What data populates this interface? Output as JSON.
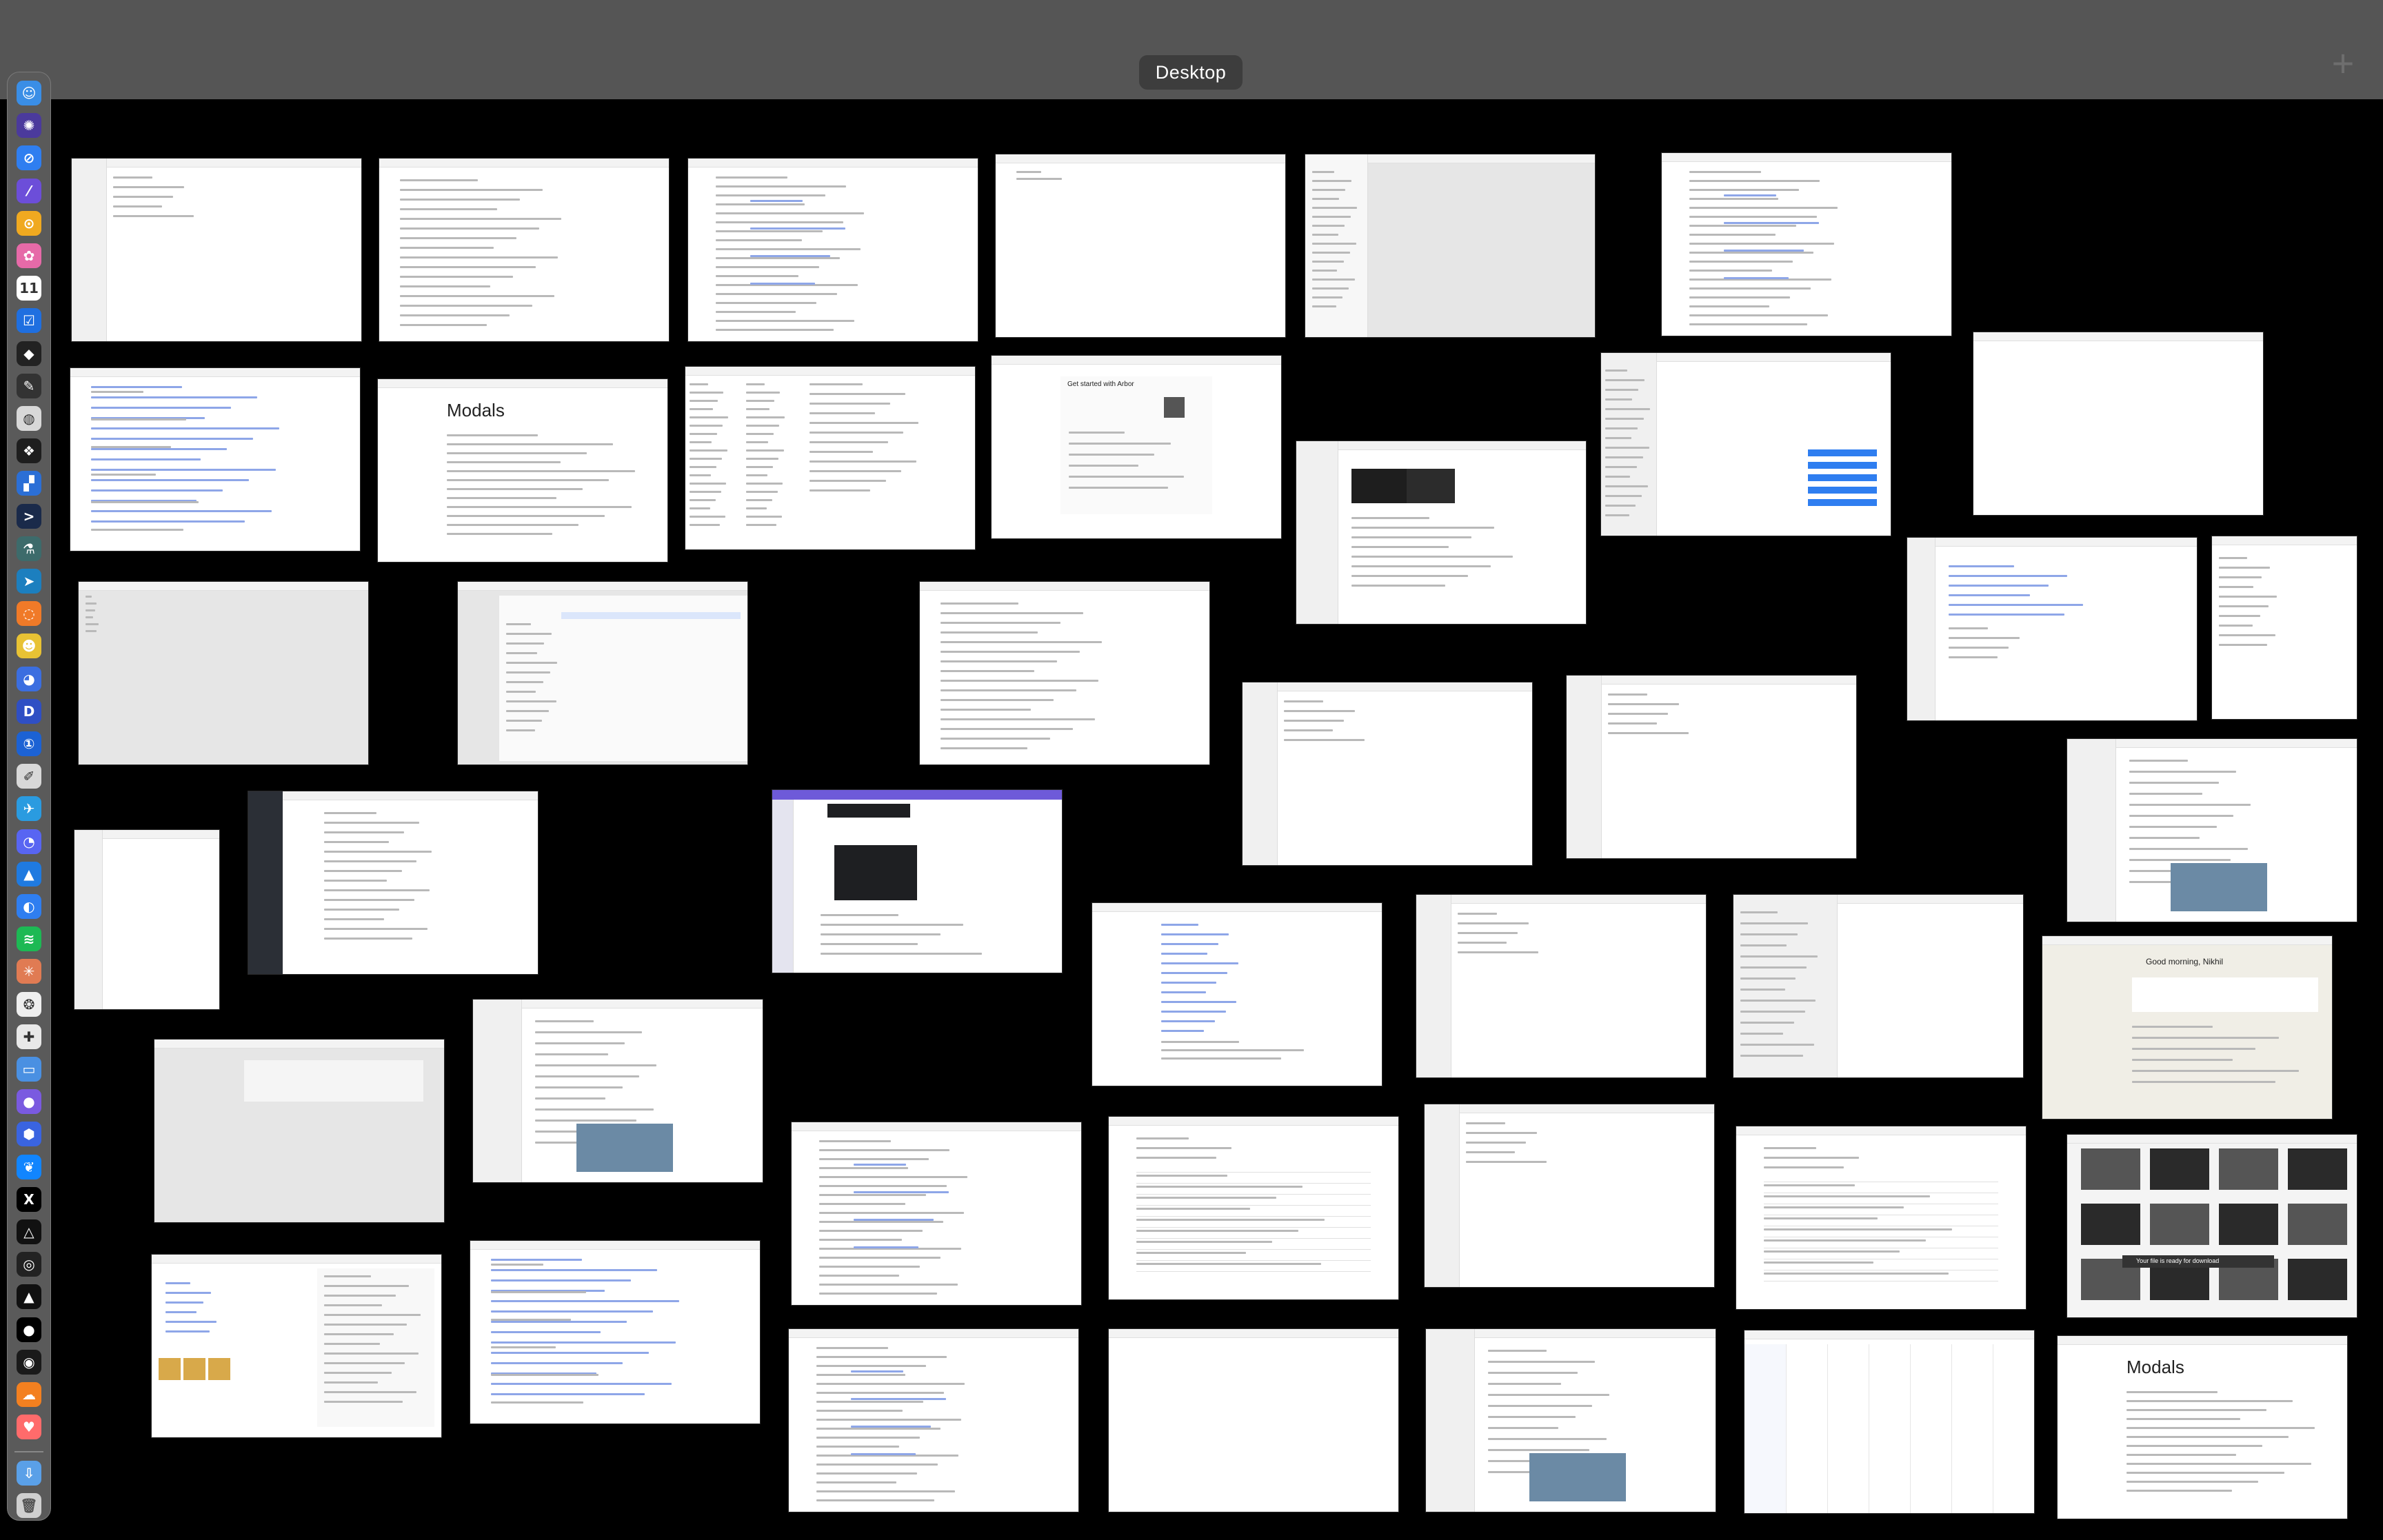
{
  "mission_control": {
    "space_label": "Desktop",
    "add_space_glyph": "+"
  },
  "dock": {
    "apps": [
      {
        "name": "finder-icon",
        "color": "#3a8ee6",
        "glyph": "☺"
      },
      {
        "name": "ai-assistant-icon",
        "color": "#4b3a9c",
        "glyph": "✺"
      },
      {
        "name": "safari-icon",
        "color": "#2f7ef0",
        "glyph": "⊘"
      },
      {
        "name": "arc-browser-icon",
        "color": "#6c4ed9",
        "glyph": "⁄"
      },
      {
        "name": "notes-app-icon",
        "color": "#f0a920",
        "glyph": "⊙"
      },
      {
        "name": "photos-icon",
        "color": "#e66aa8",
        "glyph": "✿"
      },
      {
        "name": "calendar-icon",
        "color": "#ffffff",
        "glyph": "11"
      },
      {
        "name": "tasks-icon",
        "color": "#1f6fe0",
        "glyph": "☑"
      },
      {
        "name": "cube-app-icon",
        "color": "#222222",
        "glyph": "◆"
      },
      {
        "name": "pen-app-icon",
        "color": "#333333",
        "glyph": "✎"
      },
      {
        "name": "globe-app-icon",
        "color": "#d8d8d8",
        "glyph": "◍"
      },
      {
        "name": "figma-icon",
        "color": "#1e1e1e",
        "glyph": "❖"
      },
      {
        "name": "copilot-icon",
        "color": "#2b6fd6",
        "glyph": "▞"
      },
      {
        "name": "terminal-icon",
        "color": "#1a2a4a",
        "glyph": ">"
      },
      {
        "name": "lab-app-icon",
        "color": "#3d6b6b",
        "glyph": "⚗"
      },
      {
        "name": "cursor-icon",
        "color": "#1c7fbf",
        "glyph": "➤"
      },
      {
        "name": "ring-app-icon",
        "color": "#f07a28",
        "glyph": "◌"
      },
      {
        "name": "yellow-app-icon",
        "color": "#e8c234",
        "glyph": "☻"
      },
      {
        "name": "chat-app-icon",
        "color": "#3b6ee0",
        "glyph": "◕"
      },
      {
        "name": "d-app-icon",
        "color": "#2f4fc4",
        "glyph": "D"
      },
      {
        "name": "1password-icon",
        "color": "#1c62d4",
        "glyph": "①"
      },
      {
        "name": "script-app-icon",
        "color": "#d8d8d8",
        "glyph": "✐"
      },
      {
        "name": "telegram-icon",
        "color": "#2a9be0",
        "glyph": "✈"
      },
      {
        "name": "discord-icon",
        "color": "#5865f2",
        "glyph": "◔"
      },
      {
        "name": "transmit-icon",
        "color": "#1f7ae0",
        "glyph": "▲"
      },
      {
        "name": "browser-c-icon",
        "color": "#2f7ef0",
        "glyph": "◐"
      },
      {
        "name": "spotify-icon",
        "color": "#1db954",
        "glyph": "≋"
      },
      {
        "name": "claude-icon",
        "color": "#e07b53",
        "glyph": "✳"
      },
      {
        "name": "chatgpt-icon",
        "color": "#eeeeee",
        "glyph": "❂"
      },
      {
        "name": "slack-icon",
        "color": "#e8e8e8",
        "glyph": "✚"
      },
      {
        "name": "screens-app-icon",
        "color": "#4a90e2",
        "glyph": "▭"
      },
      {
        "name": "orb-app-icon",
        "color": "#7a5ae0",
        "glyph": "●"
      },
      {
        "name": "vpn-app-icon",
        "color": "#3a64e0",
        "glyph": "⬢"
      },
      {
        "name": "bluesky-icon",
        "color": "#1185fe",
        "glyph": "❦"
      },
      {
        "name": "x-app-icon",
        "color": "#000000",
        "glyph": "X"
      },
      {
        "name": "delta-app-icon",
        "color": "#111111",
        "glyph": "△"
      },
      {
        "name": "audio-app-icon",
        "color": "#222222",
        "glyph": "◎"
      },
      {
        "name": "a-app-icon",
        "color": "#111111",
        "glyph": "▲"
      },
      {
        "name": "circle-app-icon",
        "color": "#000000",
        "glyph": "●"
      },
      {
        "name": "disc-app-icon",
        "color": "#1a1a1a",
        "glyph": "◉"
      },
      {
        "name": "cloud-app-icon",
        "color": "#f38020",
        "glyph": "☁"
      },
      {
        "name": "health-app-icon",
        "color": "#ff6b6b",
        "glyph": "♥"
      }
    ],
    "utilities": [
      {
        "name": "downloads-folder-icon",
        "color": "#5aa0e8",
        "glyph": "⇩"
      },
      {
        "name": "trash-icon",
        "color": "#cfcfcf",
        "glyph": "🗑"
      }
    ]
  },
  "windows": [
    {
      "name": "window-thumbnail-01",
      "style": "side-light"
    },
    {
      "name": "window-thumbnail-02",
      "style": "text"
    },
    {
      "name": "window-thumbnail-03",
      "style": "code"
    },
    {
      "name": "window-thumbnail-04",
      "style": "blank-text"
    },
    {
      "name": "window-thumbnail-05",
      "style": "side-gray"
    },
    {
      "name": "window-thumbnail-06",
      "style": "code"
    },
    {
      "name": "window-thumbnail-07",
      "style": "code-blue"
    },
    {
      "name": "window-thumbnail-08",
      "style": "doc"
    },
    {
      "name": "window-thumbnail-09",
      "style": "columns"
    },
    {
      "name": "window-thumbnail-10",
      "style": "modal"
    },
    {
      "name": "window-thumbnail-11",
      "style": "chat-dark"
    },
    {
      "name": "window-thumbnail-12",
      "style": "messages"
    },
    {
      "name": "window-thumbnail-13",
      "style": "blank"
    },
    {
      "name": "window-thumbnail-14",
      "style": "gray"
    },
    {
      "name": "window-thumbnail-15",
      "style": "finder"
    },
    {
      "name": "window-thumbnail-16",
      "style": "text"
    },
    {
      "name": "window-thumbnail-17",
      "style": "editor"
    },
    {
      "name": "window-thumbnail-18",
      "style": "editor-narrow"
    },
    {
      "name": "window-thumbnail-19",
      "style": "side-light"
    },
    {
      "name": "window-thumbnail-20",
      "style": "side-light"
    },
    {
      "name": "window-thumbnail-21",
      "style": "social"
    },
    {
      "name": "window-thumbnail-22",
      "style": "blank-small"
    },
    {
      "name": "window-thumbnail-23",
      "style": "side-dark"
    },
    {
      "name": "window-thumbnail-24",
      "style": "discord"
    },
    {
      "name": "window-thumbnail-25",
      "style": "list-blue"
    },
    {
      "name": "window-thumbnail-26",
      "style": "side-light"
    },
    {
      "name": "window-thumbnail-27",
      "style": "chat-list"
    },
    {
      "name": "window-thumbnail-28",
      "style": "claude"
    },
    {
      "name": "window-thumbnail-29",
      "style": "gray-center"
    },
    {
      "name": "window-thumbnail-30",
      "style": "social"
    },
    {
      "name": "window-thumbnail-31",
      "style": "code"
    },
    {
      "name": "window-thumbnail-32",
      "style": "table"
    },
    {
      "name": "window-thumbnail-33",
      "style": "side-light"
    },
    {
      "name": "window-thumbnail-34",
      "style": "table"
    },
    {
      "name": "window-thumbnail-35",
      "style": "dark-grid"
    },
    {
      "name": "window-thumbnail-36",
      "style": "cats"
    },
    {
      "name": "window-thumbnail-37",
      "style": "code-blue"
    },
    {
      "name": "window-thumbnail-38",
      "style": "code"
    },
    {
      "name": "window-thumbnail-39",
      "style": "blank"
    },
    {
      "name": "window-thumbnail-40",
      "style": "social"
    },
    {
      "name": "window-thumbnail-41",
      "style": "calendar"
    },
    {
      "name": "window-thumbnail-42",
      "style": "doc"
    }
  ],
  "window_text": {
    "modal_title": "Get started with Arbor",
    "doc_title": "Modals",
    "greeting": "Good morning, Nikhil",
    "download_toast": "Your file is ready for download"
  }
}
